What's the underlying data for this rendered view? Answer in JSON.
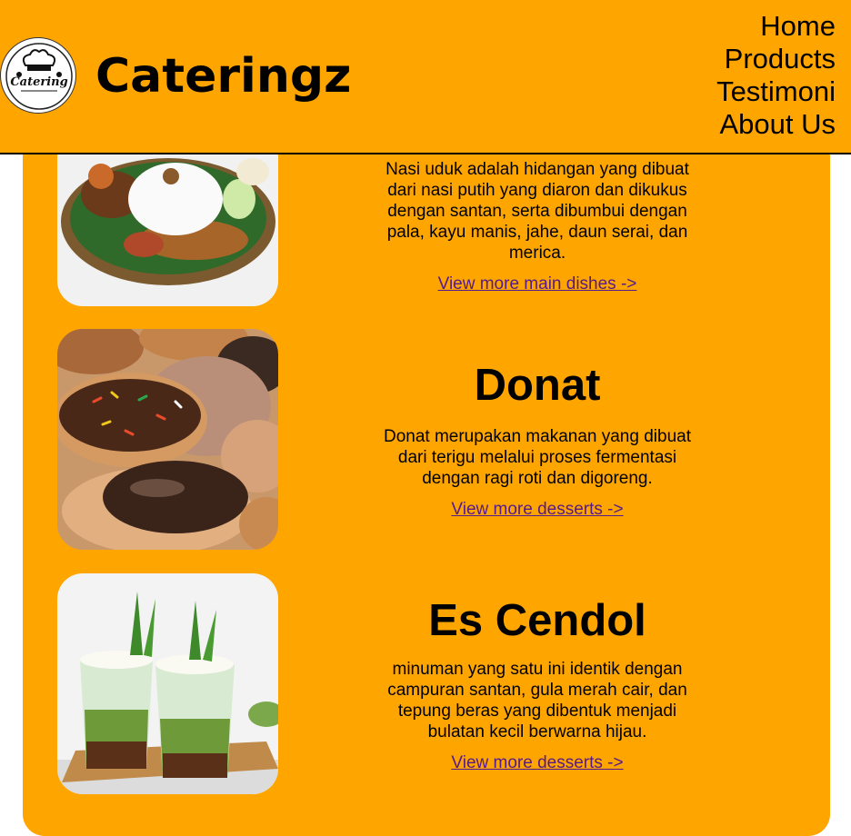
{
  "header": {
    "brand": "Cateringz",
    "nav": [
      "Home",
      "Products",
      "Testimoni",
      "About Us"
    ],
    "accent_color": "#ffa500"
  },
  "items": [
    {
      "title": "",
      "description": "Nasi uduk adalah hidangan yang dibuat dari nasi putih yang diaron dan dikukus dengan santan, serta dibumbui dengan pala, kayu manis, jahe, daun serai, dan merica.",
      "link": "View more main dishes ->",
      "image": "nasi-uduk-photo"
    },
    {
      "title": "Donat",
      "description": "Donat merupakan makanan yang dibuat dari terigu melalui proses fermentasi dengan ragi roti dan digoreng.",
      "link": "View more desserts ->",
      "image": "donut-photo"
    },
    {
      "title": "Es Cendol",
      "description": "minuman yang satu ini identik dengan campuran santan, gula merah cair, dan tepung beras yang dibentuk menjadi bulatan kecil berwarna hijau.",
      "link": "View more desserts ->",
      "image": "es-cendol-photo"
    }
  ]
}
